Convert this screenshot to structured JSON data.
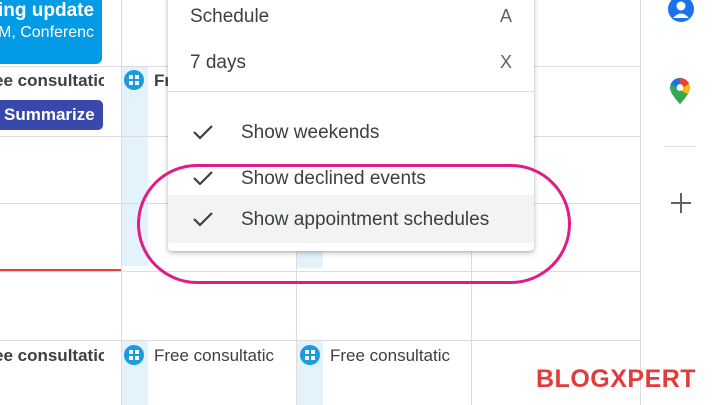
{
  "events": {
    "event_title": "ing update",
    "event_subtitle": "M, Conferenc",
    "consult_left_row1": "ee consultatic",
    "summarize_label": "Summarize",
    "col2_row1_partial": "Fr",
    "consult_left_row2": "ee consultatic",
    "consult_col2_row2": "Free consultatic",
    "consult_col3_row2": "Free consultatic"
  },
  "menu": {
    "items": [
      {
        "label": "Schedule",
        "shortcut": "A"
      },
      {
        "label": "7 days",
        "shortcut": "X"
      }
    ],
    "toggles": [
      {
        "label": "Show weekends",
        "checked": true
      },
      {
        "label": "Show declined events",
        "checked": true
      },
      {
        "label": "Show appointment schedules",
        "checked": true
      }
    ]
  },
  "side_panel": {
    "icons": [
      "contacts-icon",
      "maps-icon",
      "add-icon"
    ]
  },
  "watermark": {
    "text": "BLOGXPERT"
  },
  "colors": {
    "event_blue": "#039be5",
    "summarize_btn": "#3949ab",
    "appointment_bg": "#e3f2fb",
    "highlight_ring": "#e21b87",
    "now_line": "#ea4335"
  }
}
